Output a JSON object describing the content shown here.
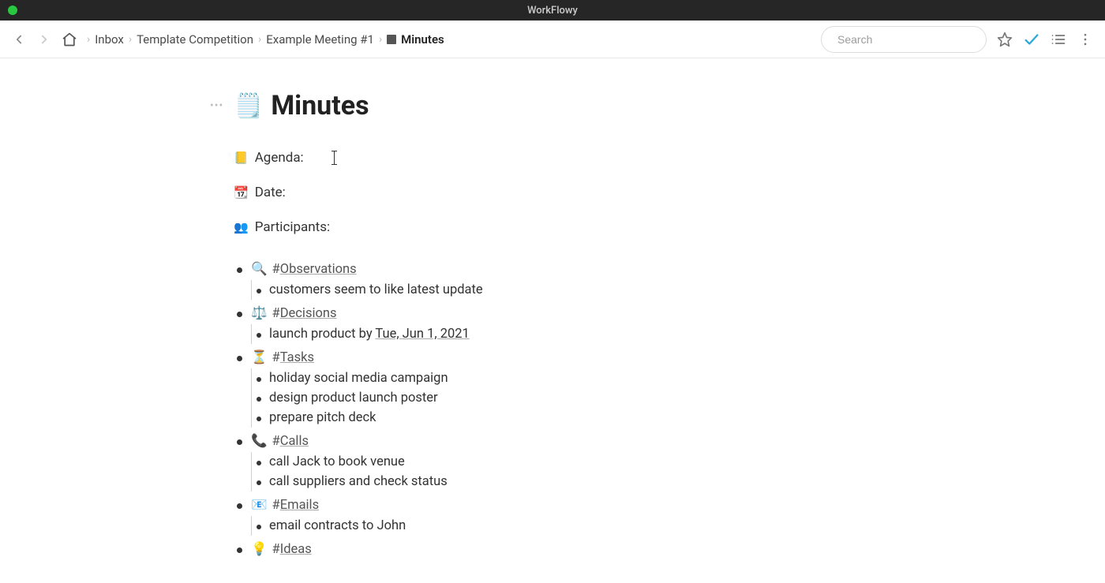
{
  "app": {
    "title": "WorkFlowy"
  },
  "breadcrumbs": {
    "items": [
      "Inbox",
      "Template Competition",
      "Example Meeting #1"
    ],
    "current": "Minutes"
  },
  "search": {
    "placeholder": "Search"
  },
  "page": {
    "title_emoji": "🗒️",
    "title": "Minutes"
  },
  "meta": {
    "agenda": {
      "emoji": "📒",
      "label": "Agenda:"
    },
    "date": {
      "emoji": "📆",
      "label": "Date:"
    },
    "participants": {
      "emoji": "👥",
      "label": "Participants:"
    }
  },
  "sections": [
    {
      "emoji": "🔍",
      "tag": "Observations",
      "items": [
        "customers seem to like latest update"
      ]
    },
    {
      "emoji": "⚖️",
      "tag": "Decisions",
      "items": [
        "launch product by Tue, Jun 1, 2021"
      ],
      "date_inline": "Tue, Jun 1, 2021"
    },
    {
      "emoji": "⏳",
      "tag": "Tasks",
      "items": [
        "holiday social media campaign",
        "design product launch poster",
        "prepare pitch deck"
      ]
    },
    {
      "emoji": "📞",
      "tag": "Calls",
      "items": [
        "call Jack to book venue",
        "call suppliers and check status"
      ]
    },
    {
      "emoji": "📧",
      "tag": "Emails",
      "items": [
        "email contracts to John"
      ]
    },
    {
      "emoji": "💡",
      "tag": "Ideas",
      "items": []
    }
  ]
}
